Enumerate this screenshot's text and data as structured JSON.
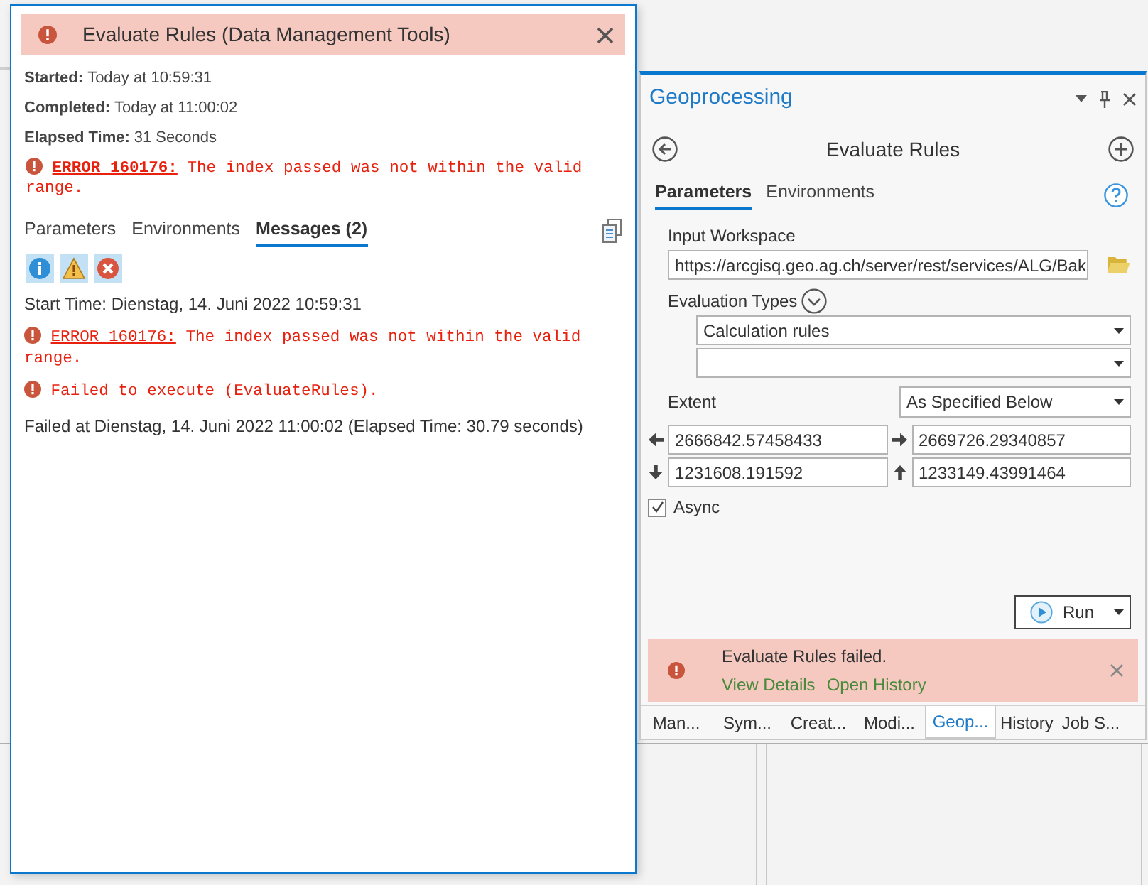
{
  "result_popup": {
    "title": "Evaluate Rules (Data Management Tools)",
    "summary": [
      {
        "label": "Started:",
        "value": "Today at 10:59:31"
      },
      {
        "label": "Completed:",
        "value": "Today at 11:00:02"
      },
      {
        "label": "Elapsed Time:",
        "value": "31 Seconds"
      }
    ],
    "error": {
      "code": "ERROR 160176:",
      "text": "The index passed was not within the valid range."
    },
    "tabs": [
      {
        "label": "Parameters",
        "selected": false
      },
      {
        "label": "Environments",
        "selected": false
      },
      {
        "label": "Messages (2)",
        "selected": true
      }
    ],
    "filters": [
      {
        "kind": "info",
        "selected": true
      },
      {
        "kind": "warning",
        "selected": true
      },
      {
        "kind": "error",
        "selected": true
      }
    ],
    "messages": [
      {
        "kind": "info",
        "text": "Start Time: Dienstag, 14. Juni 2022 10:59:31"
      },
      {
        "kind": "error",
        "code": "ERROR 160176:",
        "text": "The index passed was not within the valid range."
      },
      {
        "kind": "error",
        "text": "Failed to execute (EvaluateRules)."
      },
      {
        "kind": "info",
        "text": "Failed at Dienstag, 14. Juni 2022 11:00:02 (Elapsed Time: 30.79 seconds)"
      }
    ]
  },
  "geoprocessing": {
    "title": "Geoprocessing",
    "tool_title": "Evaluate Rules",
    "tabs": [
      {
        "label": "Parameters",
        "selected": true
      },
      {
        "label": "Environments",
        "selected": false
      }
    ],
    "input_workspace": {
      "label": "Input Workspace",
      "value": "https://arcgisq.geo.ag.ch/server/rest/services/ALG/Bak"
    },
    "evaluation_types": {
      "label": "Evaluation Types",
      "dropdowns": [
        {
          "kind": "filled",
          "value": "Calculation rules"
        },
        {
          "kind": "empty"
        }
      ]
    },
    "extent": {
      "label": "Extent",
      "mode": "As Specified Below",
      "coordinates": [
        {
          "kind": "left",
          "value": "2666842.57458433"
        },
        {
          "kind": "right",
          "value": "2669726.29340857"
        },
        {
          "kind": "down",
          "value": "1231608.191592"
        },
        {
          "kind": "up",
          "value": "1233149.43991464"
        }
      ]
    },
    "async": {
      "label": "Async",
      "checked": true
    },
    "run_button": "Run",
    "notification": {
      "message": "Evaluate Rules failed.",
      "links": [
        "View Details",
        "Open History"
      ]
    },
    "bottom_tabs": [
      {
        "label": "Man...",
        "selected": false
      },
      {
        "label": "Sym...",
        "selected": false
      },
      {
        "label": "Creat...",
        "selected": false
      },
      {
        "label": "Modi...",
        "selected": false
      },
      {
        "label": "Geop...",
        "selected": true
      },
      {
        "label": "History",
        "selected": false
      },
      {
        "label": "Job S...",
        "selected": false
      }
    ]
  }
}
